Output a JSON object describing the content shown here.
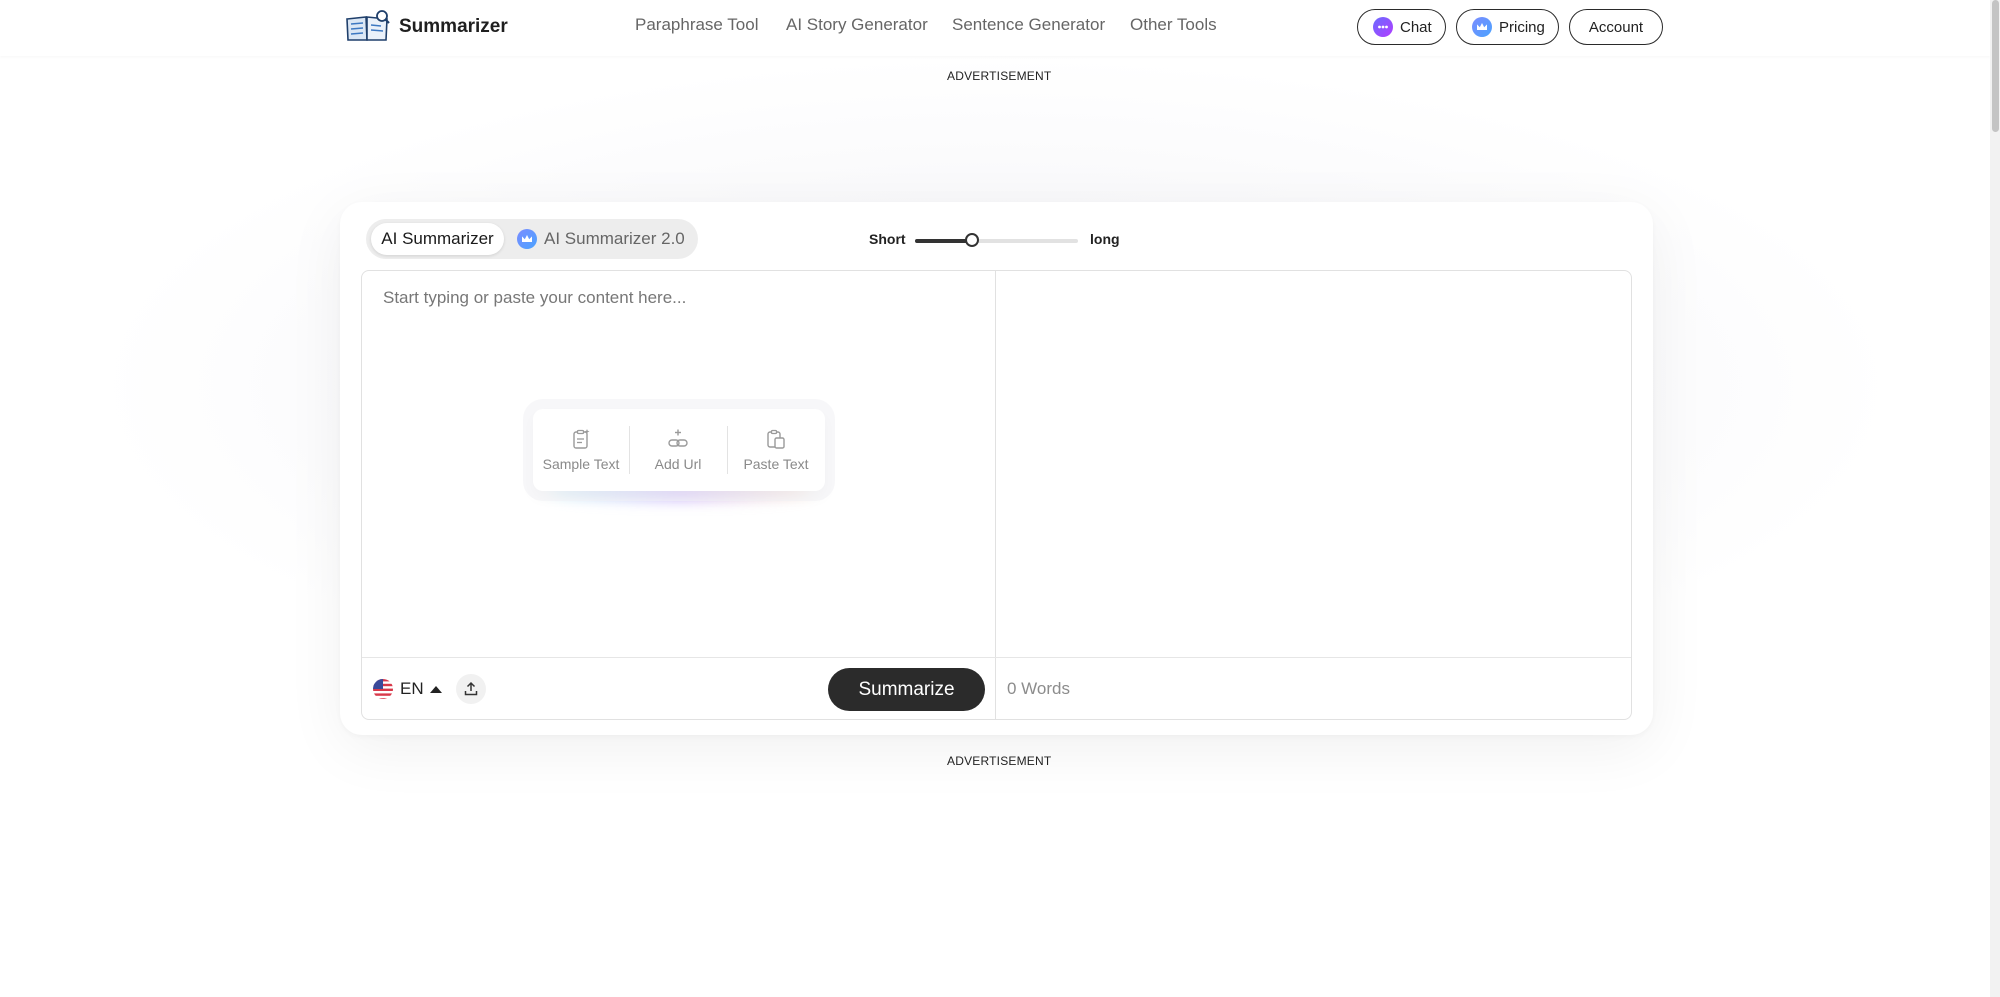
{
  "header": {
    "brand": "Summarizer",
    "nav": [
      "Paraphrase Tool",
      "AI Story Generator",
      "Sentence Generator",
      "Other Tools"
    ],
    "chat_label": "Chat",
    "pricing_label": "Pricing",
    "account_label": "Account"
  },
  "ads": {
    "top": "ADVERTISEMENT",
    "bottom": "ADVERTISEMENT"
  },
  "tabs": {
    "primary": "AI Summarizer",
    "secondary": "AI Summarizer 2.0"
  },
  "length": {
    "short_label": "Short",
    "long_label": "long",
    "value_fraction": 0.35
  },
  "editor": {
    "placeholder": "Start typing or paste your content here...",
    "value": ""
  },
  "quick_actions": [
    "Sample Text",
    "Add Url",
    "Paste Text"
  ],
  "footer": {
    "language": "EN",
    "summarize_label": "Summarize",
    "word_count": "0 Words"
  },
  "colors": {
    "accent_dark": "#2b2b2b",
    "chat_gradient": [
      "#6b6bff",
      "#b13cff"
    ],
    "crown_gradient": [
      "#7b8cff",
      "#4aa3ff"
    ]
  }
}
